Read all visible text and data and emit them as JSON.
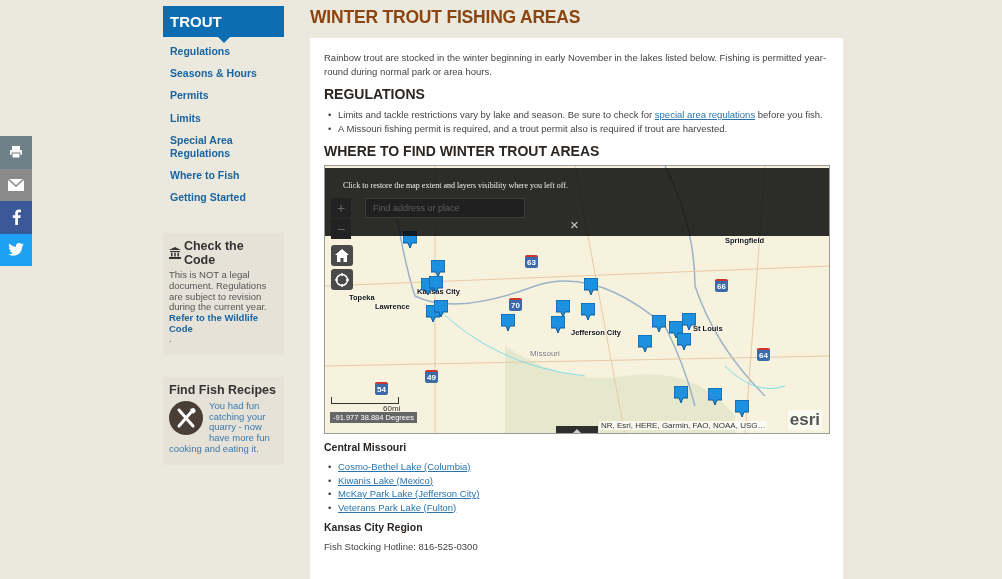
{
  "share_buttons": [
    {
      "kind": "print"
    },
    {
      "kind": "email"
    },
    {
      "kind": "facebook"
    },
    {
      "kind": "twitter"
    }
  ],
  "sidebar": {
    "title": "TROUT",
    "items": [
      "Regulations",
      "Seasons & Hours",
      "Permits",
      "Limits",
      "Special Area Regulations",
      "Where to Fish",
      "Getting Started"
    ]
  },
  "check_code": {
    "title": "Check the Code",
    "text": "This is NOT a legal document. Regulations are subject to revision during the current year.",
    "link": "Refer to the Wildlife Code",
    "after": "."
  },
  "recipes": {
    "title": "Find Fish Recipes",
    "text": "You had fun catching your quarry - now have more fun cooking and eating it."
  },
  "page_title": "WINTER TROUT FISHING AREAS",
  "intro": "Rainbow trout are stocked in the winter beginning in early November in the lakes listed below. Fishing is permitted year-round during normal park or area hours.",
  "regulations": {
    "heading": "REGULATIONS",
    "items": [
      {
        "text": "Limits and tackle restrictions vary by lake and season. Be sure to check for ",
        "link": "special area regulations",
        "after": " before you fish."
      },
      {
        "text": "A Missouri fishing permit is required, and a trout permit also is required if trout are harvested."
      }
    ]
  },
  "where_heading": "WHERE TO FIND WINTER TROUT AREAS",
  "list_marker": "•",
  "map": {
    "search_placeholder": "Find address or place",
    "zoom_in": "+",
    "zoom_out": "−",
    "notice": "Click to restore the map extent and layers visibility where you left off.",
    "close": "×",
    "places": [
      "Topeka",
      "Lawrence",
      "Kansas City",
      "Jefferson City",
      "Missouri",
      "St Louis",
      "Springfield"
    ],
    "highways": [
      "63",
      "70",
      "66",
      "64",
      "49",
      "54"
    ],
    "scale": "60mi",
    "coordinates": "-91.977 38.884 Degrees",
    "attribution": "NR, Esri, HERE, Garmin, FAO, NOAA, USG…",
    "logo": "esri"
  },
  "regions": [
    {
      "name": "Central Missouri",
      "lakes": [
        "Cosmo-Bethel Lake (Columbia)",
        "Kiwanis Lake (Mexico)",
        "McKay Park Lake (Jefferson City)",
        "Veterans Park Lake (Fulton)"
      ]
    },
    {
      "name": "Kansas City Region",
      "text": "Fish Stocking Hotline: 816-525-0300"
    }
  ]
}
